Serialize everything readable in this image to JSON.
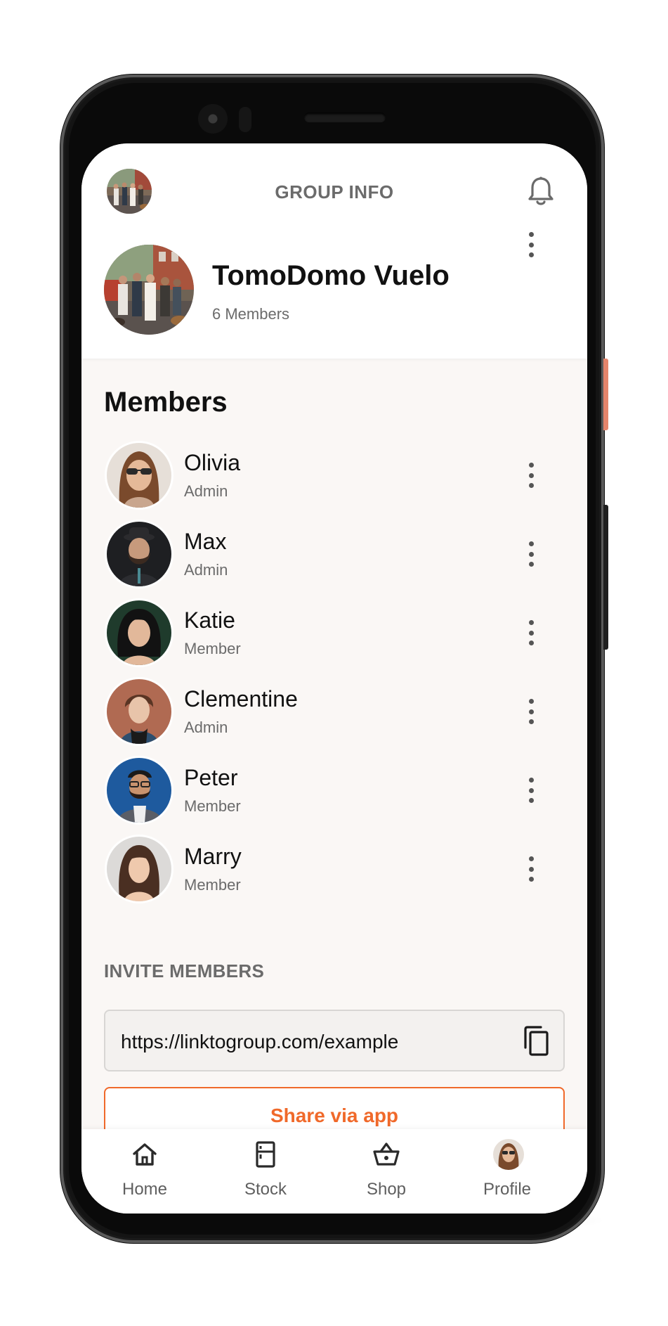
{
  "header": {
    "title": "GROUP INFO",
    "avatar_icon": "group-photo",
    "notification_icon": "bell-icon"
  },
  "group": {
    "name": "TomoDomo Vuelo",
    "member_count": "6 Members",
    "menu_icon": "more-vertical-icon"
  },
  "members_section": {
    "title": "Members",
    "members": [
      {
        "name": "Olivia",
        "role": "Admin"
      },
      {
        "name": "Max",
        "role": "Admin"
      },
      {
        "name": "Katie",
        "role": "Member"
      },
      {
        "name": "Clementine",
        "role": "Admin"
      },
      {
        "name": "Peter",
        "role": "Member"
      },
      {
        "name": "Marry",
        "role": "Member"
      }
    ]
  },
  "invite": {
    "label": "INVITE MEMBERS",
    "link": "https://linktogroup.com/example",
    "copy_icon": "copy-icon",
    "share_button": "Share via app"
  },
  "bottom_nav": {
    "items": [
      {
        "label": "Home",
        "icon": "home-icon"
      },
      {
        "label": "Stock",
        "icon": "fridge-icon"
      },
      {
        "label": "Shop",
        "icon": "basket-icon"
      },
      {
        "label": "Profile",
        "icon": "avatar"
      }
    ]
  },
  "colors": {
    "accent": "#f0692a",
    "background": "#faf7f5",
    "text_primary": "#111111",
    "text_secondary": "#6b6b6b"
  }
}
